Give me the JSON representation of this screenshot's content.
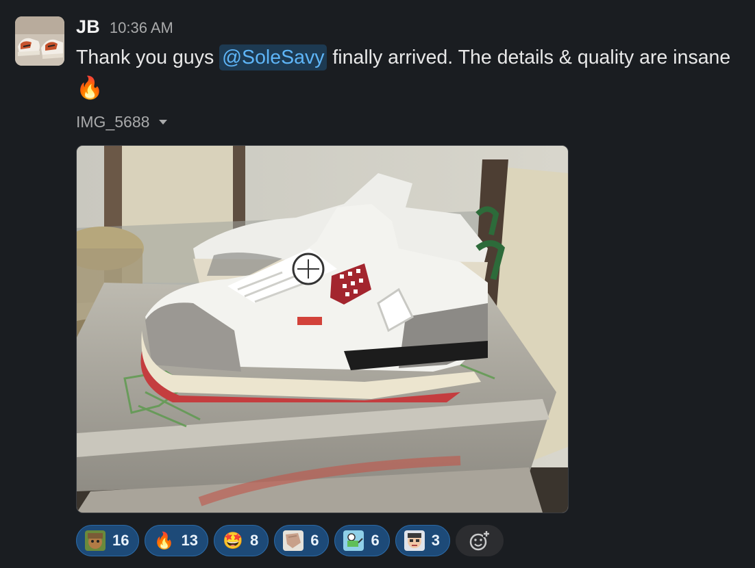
{
  "message": {
    "author": "JB",
    "time": "10:36 AM",
    "text_before": "Thank you guys ",
    "mention": "@SoleSavy",
    "text_after": " finally arrived. The details & quality are insane",
    "trailing_emoji": "🔥",
    "file_name": "IMG_5688"
  },
  "reactions": [
    {
      "icon": "character-face-icon",
      "glyph": "",
      "count": "16"
    },
    {
      "icon": "fire-icon",
      "glyph": "🔥",
      "count": "13"
    },
    {
      "icon": "star-struck-icon",
      "glyph": "🤩",
      "count": "8"
    },
    {
      "icon": "skin-hand-icon",
      "glyph": "",
      "count": "6"
    },
    {
      "icon": "cartoon-person-icon",
      "glyph": "",
      "count": "6"
    },
    {
      "icon": "pixel-face-icon",
      "glyph": "",
      "count": "3"
    }
  ],
  "colors": {
    "background": "#1a1d21",
    "mention_bg": "#1d3a52",
    "mention_fg": "#5eb5f7",
    "reaction_bg": "#1d4a78",
    "reaction_border": "#2b6aa7"
  }
}
